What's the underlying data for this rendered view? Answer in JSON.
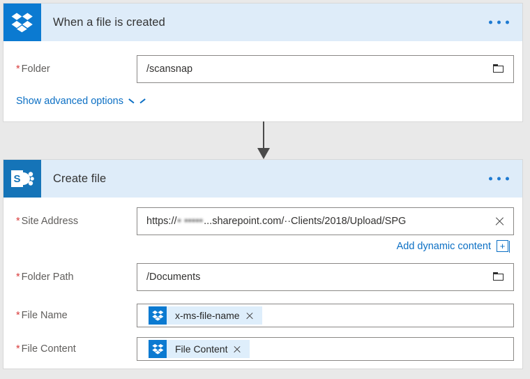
{
  "trigger_card": {
    "icon": "dropbox-icon",
    "title": "When a file is created",
    "overflow_label": "...",
    "fields": [
      {
        "label": "Folder",
        "required": true,
        "value": "/scansnap",
        "trailing_icon": "folder-picker-icon"
      }
    ],
    "advanced_link": "Show advanced options"
  },
  "action_card": {
    "icon": "sharepoint-icon",
    "title": "Create file",
    "overflow_label": "...",
    "site_address": {
      "label": "Site Address",
      "required": true,
      "prefix": "https://",
      "redacted": "• •••••",
      "suffix": "...sharepoint.com/··Clients/2018/Upload/SPG",
      "trailing_icon": "clear-icon"
    },
    "dynamic_content": {
      "text": "Add dynamic content",
      "plus": "+"
    },
    "folder_path": {
      "label": "Folder Path",
      "required": true,
      "value": "/Documents",
      "trailing_icon": "folder-picker-icon"
    },
    "file_name": {
      "label": "File Name",
      "required": true,
      "token": {
        "icon": "dropbox-icon",
        "label": "x-ms-file-name",
        "remove": "×"
      }
    },
    "file_content": {
      "label": "File Content",
      "required": true,
      "token": {
        "icon": "dropbox-icon",
        "label": "File Content",
        "remove": "×"
      }
    }
  },
  "connector": {
    "name": "flow-arrow"
  },
  "colors": {
    "header_band": "#deecf9",
    "dropbox_blue": "#0b7ad1",
    "sharepoint_blue": "#1574b8",
    "link_blue": "#0b6fc4",
    "required_red": "#d93b3b",
    "page_bg": "#e9e9e9",
    "token_bg": "#deeefb"
  }
}
